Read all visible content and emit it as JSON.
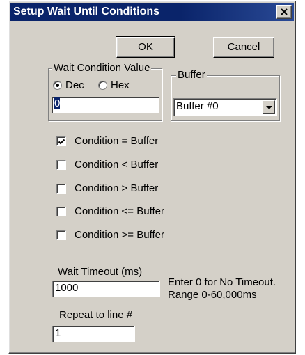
{
  "window": {
    "title": "Setup Wait Until Conditions"
  },
  "buttons": {
    "ok": "OK",
    "cancel": "Cancel"
  },
  "wait_condition": {
    "group_label": "Wait Condition Value",
    "radio_dec": "Dec",
    "radio_hex": "Hex",
    "selected_radix": "Dec",
    "value": "0"
  },
  "buffer": {
    "group_label": "Buffer",
    "selected": "Buffer #0"
  },
  "conditions": [
    {
      "label": "Condition = Buffer",
      "checked": true
    },
    {
      "label": "Condition < Buffer",
      "checked": false
    },
    {
      "label": "Condition > Buffer",
      "checked": false
    },
    {
      "label": "Condition <= Buffer",
      "checked": false
    },
    {
      "label": "Condition >= Buffer",
      "checked": false
    }
  ],
  "timeout": {
    "label": "Wait Timeout (ms)",
    "value": "1000",
    "hint_line1": "Enter 0 for No Timeout.",
    "hint_line2": "Range 0-60,000ms"
  },
  "repeat": {
    "label": "Repeat to line #",
    "value": "1"
  },
  "icons": {
    "close": "close-icon",
    "dropdown": "chevron-down-icon",
    "check": "checkmark-icon"
  }
}
